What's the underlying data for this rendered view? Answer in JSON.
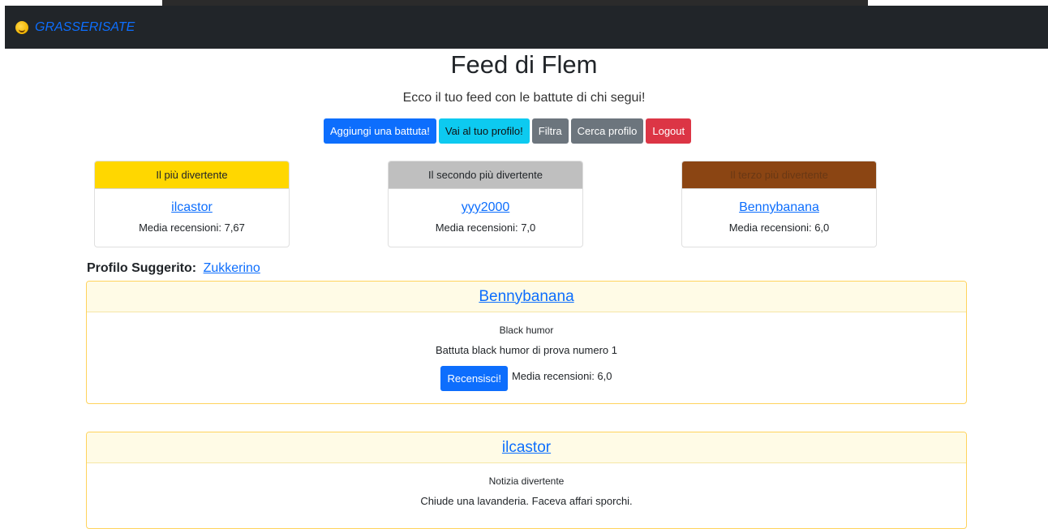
{
  "navbar": {
    "brand": "GRASSERISATE",
    "brand_icon": "grinning-face-icon",
    "bg": "#212529",
    "brand_color": "#0d6efd"
  },
  "header": {
    "title": "Feed di Flem",
    "subtitle": "Ecco il tuo feed con le battute di chi segui!"
  },
  "actions": {
    "add_joke": "Aggiungi una battuta!",
    "profile": "Vai al tuo profilo!",
    "filter": "Filtra",
    "search": "Cerca profilo",
    "logout": "Logout"
  },
  "rankings": [
    {
      "title": "Il più divertente",
      "user": "ilcastor",
      "average": "Media recensioni: 7,67",
      "color": "#ffd700"
    },
    {
      "title": "Il secondo più divertente",
      "user": "yyy2000",
      "average": "Media recensioni: 7,0",
      "color": "#bfbfbf"
    },
    {
      "title": "Il terzo più divertente",
      "user": "Bennybanana",
      "average": "Media recensioni: 6,0",
      "color": "#8b4513"
    }
  ],
  "suggested": {
    "label": "Profilo Suggerito:",
    "user": "Zukkerino"
  },
  "posts": [
    {
      "author": "Bennybanana",
      "category": "Black humor",
      "text": "Battuta black humor di prova numero 1",
      "review_button": "Recensisci!",
      "average": "Media recensioni: 6,0"
    },
    {
      "author": "ilcastor",
      "category": "Notizia divertente",
      "text": "Chiude una lavanderia. Faceva affari sporchi."
    }
  ]
}
